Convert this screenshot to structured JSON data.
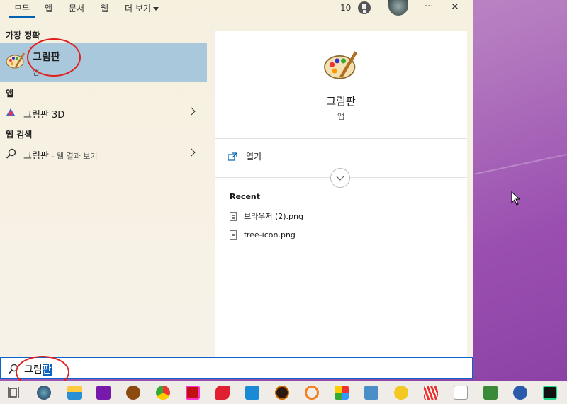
{
  "tabs": [
    {
      "label": "모두",
      "active": true
    },
    {
      "label": "앱"
    },
    {
      "label": "문서"
    },
    {
      "label": "웹"
    },
    {
      "label": "더 보기"
    }
  ],
  "header_right": {
    "badge_count": "10",
    "more": "···",
    "close": "✕"
  },
  "sections": {
    "best_match": "가장 정확",
    "apps": "앱",
    "web": "웹 검색"
  },
  "best_match": {
    "title": "그림판",
    "subtitle": "앱"
  },
  "apps": [
    {
      "label": "그림판 3D"
    }
  ],
  "web": [
    {
      "label": "그림판",
      "sub": " - 웹 결과 보기"
    }
  ],
  "preview": {
    "title": "그림판",
    "subtitle": "앱",
    "open_label": "열기",
    "recent_heading": "Recent",
    "recent": [
      "브라우저 (2).png",
      "free-icon.png"
    ]
  },
  "search": {
    "typed": "그림",
    "selected": "판"
  },
  "colors": {
    "accent": "#0063b1",
    "highlight": "#aac8dc",
    "annotation": "#e02020"
  },
  "taskbar_icons": [
    "task-view-icon",
    "edge-like-icon",
    "onenote-icon",
    "file-explorer-icon",
    "game-icon",
    "chrome-icon",
    "app-red-icon",
    "app-red2-icon",
    "vscode-icon",
    "app-dark-icon",
    "search-app-icon",
    "app-color-icon",
    "hangul-icon",
    "app-yellow-icon",
    "app-stripes-icon",
    "notepad-icon",
    "app-green-icon",
    "app-n-icon",
    "pycharm-icon"
  ]
}
